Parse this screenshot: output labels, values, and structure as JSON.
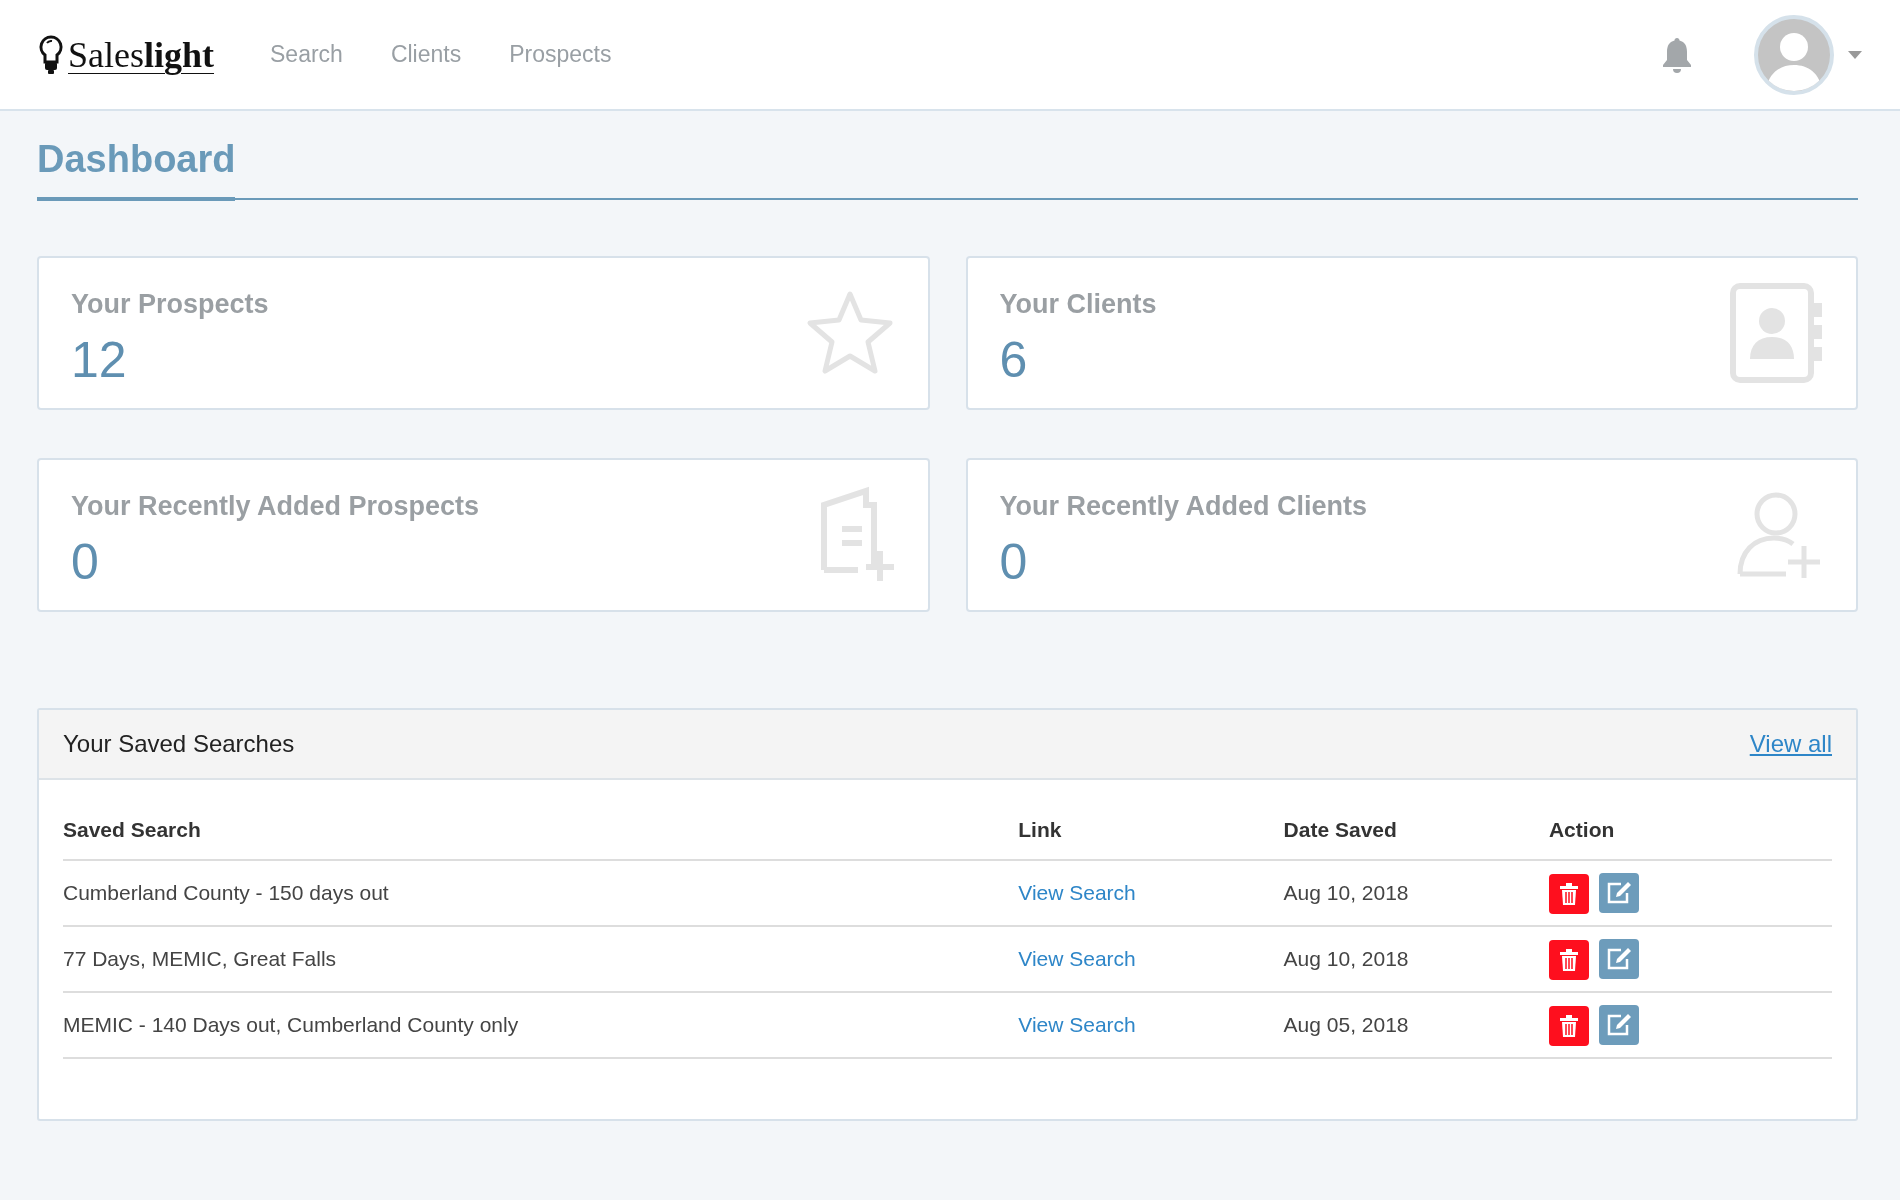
{
  "navbar": {
    "logo": "Sales**light**",
    "links": [
      {
        "label": "Search"
      },
      {
        "label": "Clients"
      },
      {
        "label": "Prospects"
      }
    ]
  },
  "page": {
    "title": "Dashboard"
  },
  "stats": [
    {
      "kind": "star",
      "title": "Your Prospects",
      "value": "12"
    },
    {
      "kind": "contacts",
      "title": "Your Clients",
      "value": "6"
    },
    {
      "kind": "document-add",
      "title": "Your Recently Added Prospects",
      "value": "0"
    },
    {
      "kind": "user-add",
      "title": "Your Recently Added Clients",
      "value": "0"
    }
  ],
  "saved_searches": {
    "title": "Your Saved Searches",
    "view_all": "View all",
    "columns": [
      "Saved Search",
      "Link",
      "Date Saved",
      "Action"
    ],
    "rows": [
      {
        "name": "Cumberland County - 150 days out",
        "link": "View Search",
        "date": "Aug 10, 2018"
      },
      {
        "name": "77 Days, MEMIC, Great Falls",
        "link": "View Search",
        "date": "Aug 10, 2018"
      },
      {
        "name": "MEMIC - 140 Days out, Cumberland County only",
        "link": "View Search",
        "date": "Aug 05, 2018"
      }
    ]
  }
}
